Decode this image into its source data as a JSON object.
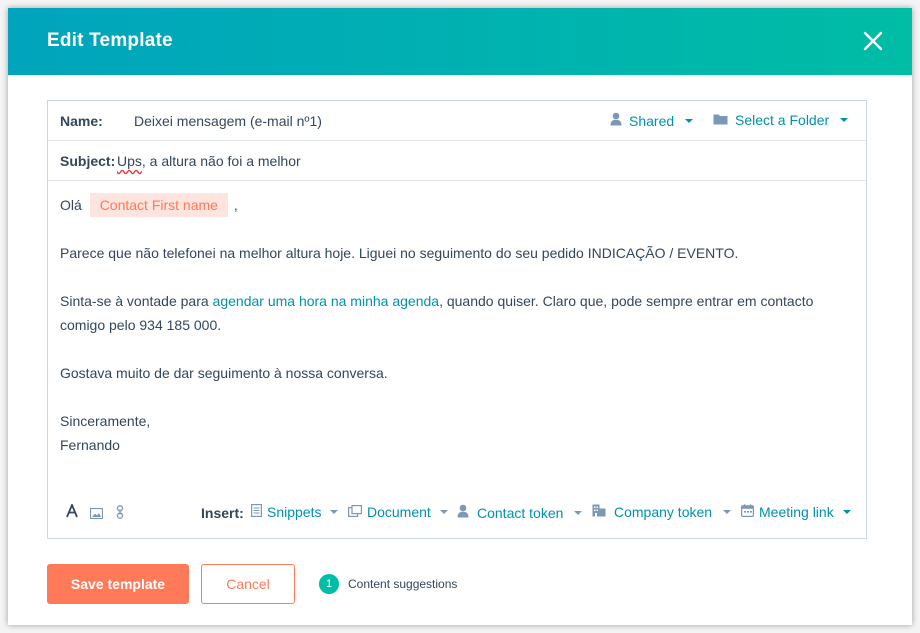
{
  "modal": {
    "title": "Edit Template",
    "close_icon": "close-icon"
  },
  "header_row": {
    "name_label": "Name:",
    "name_value": "Deixei mensagem (e-mail nº1)",
    "shared_label": "Shared",
    "folder_label": "Select a Folder"
  },
  "subject_row": {
    "label": "Subject:",
    "value_misspelled": "Ups",
    "value_rest": ", a altura não foi a melhor"
  },
  "body": {
    "greeting": "Olá",
    "token": "Contact First name",
    "greeting_after": ",",
    "para1": "Parece que não telefonei na melhor altura hoje. Liguei no seguimento do seu pedido INDICAÇÃO / EVENTO.",
    "para2_before": "Sinta-se à vontade para ",
    "para2_link": "agendar uma hora na minha agenda",
    "para2_after": ", quando quiser. Claro que, pode sempre entrar em contacto",
    "para2_line2": "comigo pelo 934 185 000.",
    "para3": "Gostava muito de dar seguimento à nossa conversa.",
    "closing": "Sinceramente,",
    "signature": "Fernando"
  },
  "toolbar": {
    "insert_label": "Insert:",
    "items": {
      "snippets": "Snippets",
      "document": "Document",
      "contact_token": "Contact token",
      "company_token": "Company token",
      "meeting_link": "Meeting link"
    }
  },
  "footer": {
    "save_label": "Save template",
    "cancel_label": "Cancel",
    "suggestions_count": "1",
    "suggestions_label": "Content suggestions"
  },
  "colors": {
    "header_start": "#00a4bd",
    "header_end": "#00bda5",
    "link": "#0091ae",
    "primary": "#ff7a59",
    "text": "#33475b"
  }
}
